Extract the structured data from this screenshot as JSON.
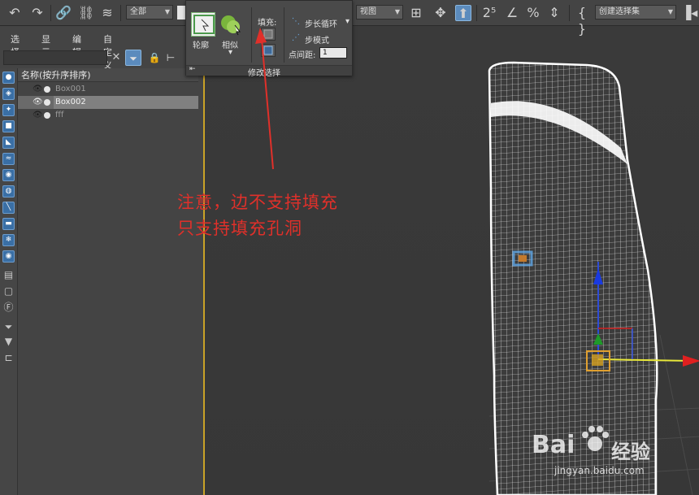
{
  "toolbar": {
    "selection_filter": "全部",
    "view_coordinate": "视图",
    "named_selection_set": "创建选择集",
    "icons": [
      "undo-icon",
      "redo-icon",
      "link-icon",
      "unlink-icon",
      "bind-space-warp-icon",
      "select-move-icon",
      "select-object-icon",
      "angle-snap-icon",
      "percent-snap-icon",
      "spinner-snap-icon",
      "edit-named-selection-icon",
      "mirror-icon"
    ]
  },
  "scene_explorer": {
    "menu": [
      "选择",
      "显示",
      "编辑",
      "自定义"
    ],
    "column_header": "名称(按升序排序)",
    "rows": [
      {
        "name": "Box001",
        "visible": false,
        "selected": false
      },
      {
        "name": "Box002",
        "visible": true,
        "selected": true
      },
      {
        "name": "fff",
        "visible": false,
        "selected": false
      }
    ]
  },
  "ribbon": {
    "outline_label": "轮廓",
    "similar_label": "相似",
    "fill_label": "填充:",
    "step_loop_label": "步长循环",
    "step_mode_label": "步模式",
    "point_spacing_label": "点间距:",
    "point_spacing_value": "1",
    "footer_label": "修改选择"
  },
  "annotation": {
    "line1": "注意，边不支持填充",
    "line2": "只支持填充孔洞",
    "color": "#e0302a"
  },
  "watermark": {
    "brand": "Bai",
    "brand2": "经验",
    "url": "jingyan.baidu.com"
  },
  "colors": {
    "panel": "#444444",
    "viewport": "#3a3a3a",
    "accent_blue": "#5b8bbd",
    "viewport_border": "#c9a227"
  }
}
